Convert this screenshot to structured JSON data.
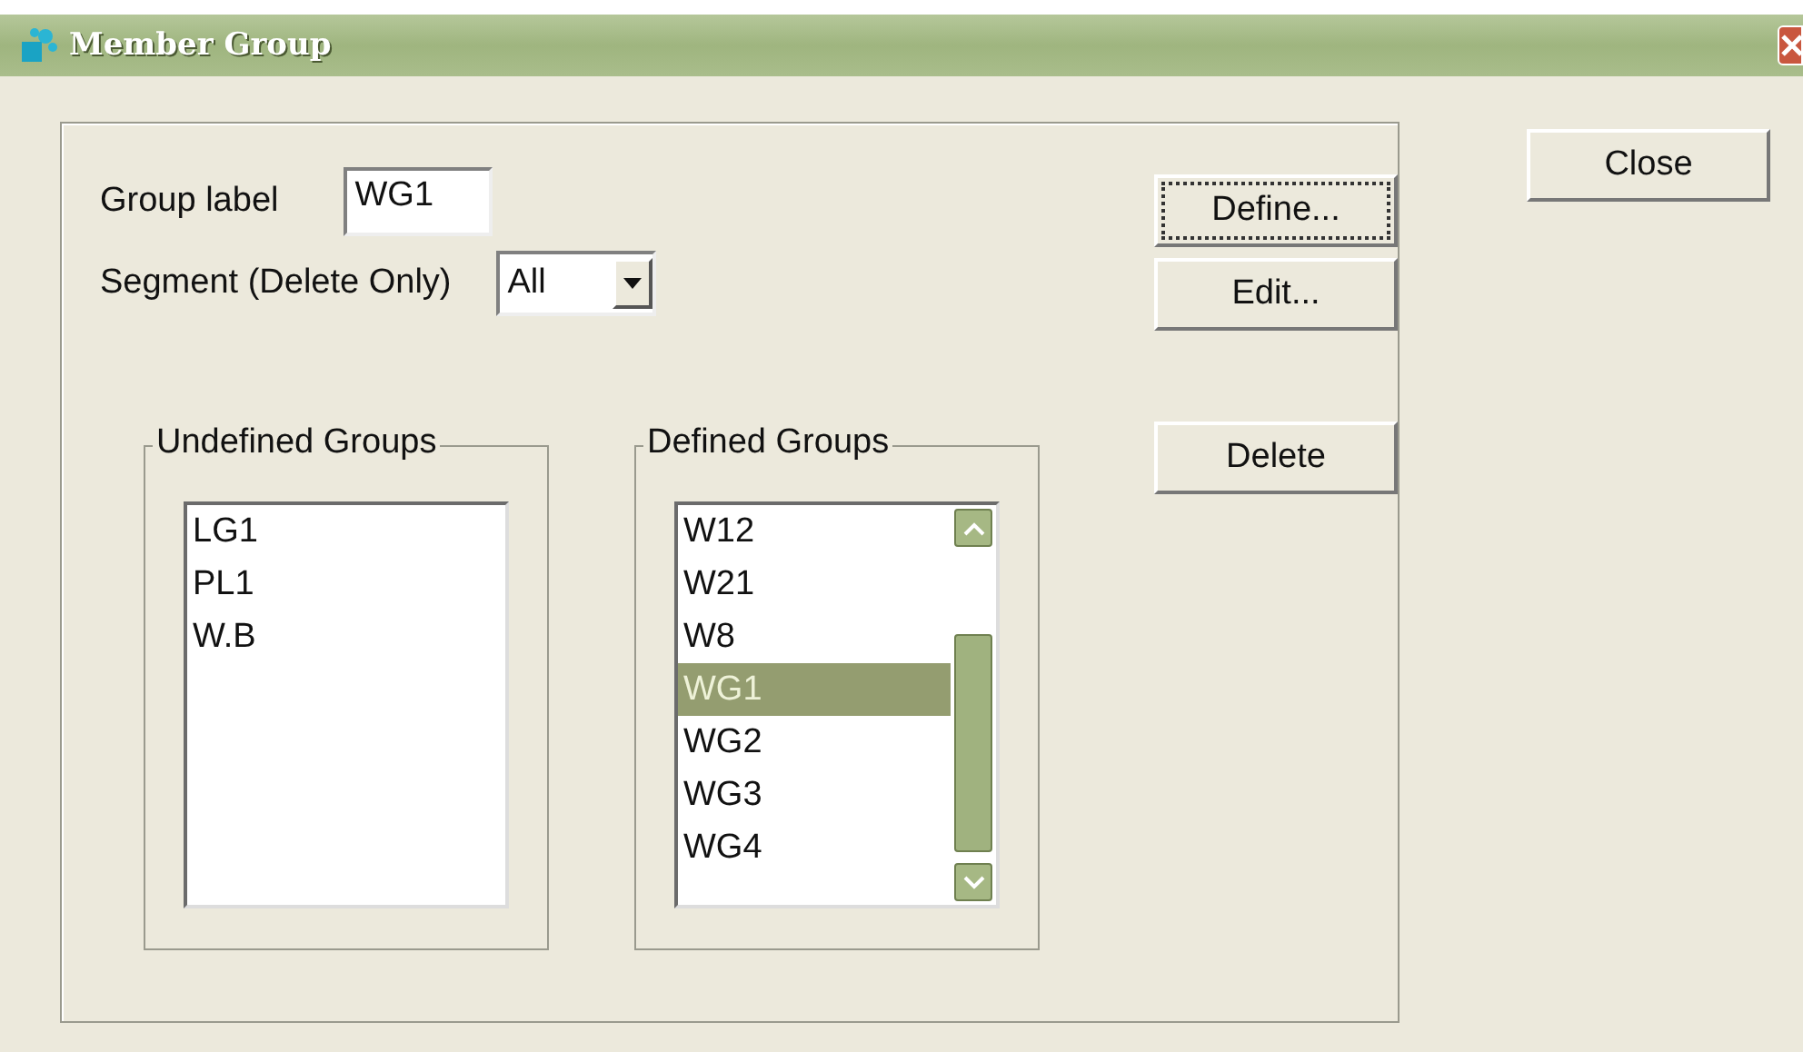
{
  "window": {
    "title": "Member Group"
  },
  "group_label": {
    "label": "Group label",
    "value": "WG1"
  },
  "segment": {
    "label": "Segment (Delete Only)",
    "value": "All"
  },
  "buttons": [
    {
      "label": "Define...",
      "focused": true
    },
    {
      "label": "Edit...",
      "focused": false
    }
  ],
  "delete_button": "Delete",
  "close_button": "Close",
  "undefined_groups": {
    "title": "Undefined Groups",
    "items": [
      {
        "label": "LG1",
        "selected": false
      },
      {
        "label": "PL1",
        "selected": false
      },
      {
        "label": "W.B",
        "selected": false
      }
    ]
  },
  "defined_groups": {
    "title": "Defined Groups",
    "items": [
      {
        "label": "W12",
        "selected": false
      },
      {
        "label": "W21",
        "selected": false
      },
      {
        "label": "W8",
        "selected": false
      },
      {
        "label": "WG1",
        "selected": true
      },
      {
        "label": "WG2",
        "selected": false
      },
      {
        "label": "WG3",
        "selected": false
      },
      {
        "label": "WG4",
        "selected": false
      }
    ]
  }
}
